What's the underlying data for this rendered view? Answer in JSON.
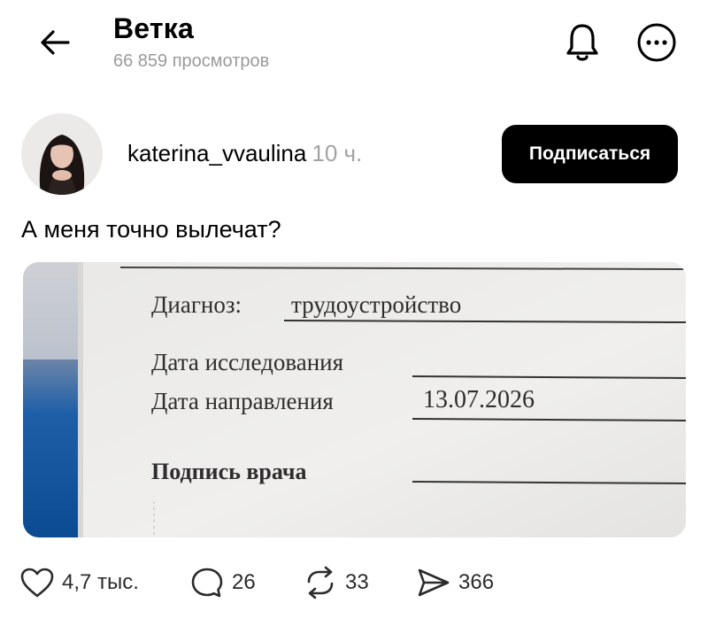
{
  "header": {
    "title": "Ветка",
    "views": "66 859 просмотров"
  },
  "post": {
    "author": "katerina_vvaulina",
    "time": "10 ч.",
    "follow_label": "Подписаться",
    "text": "А меня точно вылечат?",
    "photo": {
      "diagnosis_label": "Диагноз:",
      "diagnosis_value": "трудоустройство",
      "exam_date_label": "Дата исследования",
      "referral_date_label": "Дата направления",
      "referral_date_value": "13.07.2026",
      "signature_label": "Подпись врача"
    }
  },
  "actions": {
    "likes": "4,7 тыс.",
    "comments": "26",
    "reposts": "33",
    "shares": "366"
  },
  "icons": [
    "back-arrow-icon",
    "bell-icon",
    "more-icon",
    "heart-icon",
    "comment-icon",
    "repost-icon",
    "share-icon"
  ]
}
